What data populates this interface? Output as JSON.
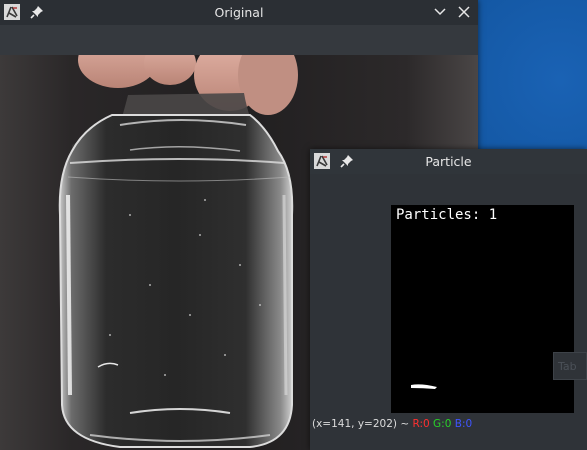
{
  "windows": {
    "original": {
      "title": "Original",
      "app_icon": "opencv-app-icon",
      "pin_icon": "pin-icon",
      "buttons": [
        "chevron-down-icon",
        "close-icon"
      ]
    },
    "particle": {
      "title": "Particle",
      "app_icon": "opencv-app-icon",
      "pin_icon": "pin-icon",
      "overlay_text": "Particles: 1",
      "side_widget_text": "Tab",
      "status": {
        "coords": "(x=141, y=202)",
        "separator": "~",
        "r": "R:0",
        "g": "G:0",
        "b": "B:0"
      }
    }
  },
  "colors": {
    "desktop": "#0b3f7a",
    "titlebar": "#2b2f34",
    "status_red": "#ff3030",
    "status_green": "#29d129",
    "status_blue": "#3f55ff"
  }
}
